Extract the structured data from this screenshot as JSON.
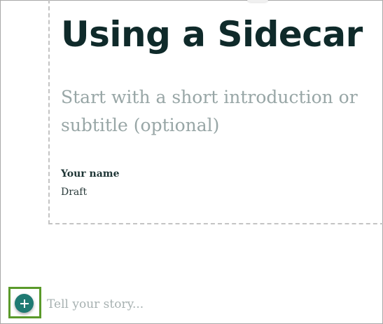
{
  "story": {
    "title": "Using a Sidecar",
    "subtitle": "Start with a short introduction or subtitle (optional)",
    "byline": {
      "name": "Your name",
      "status": "Draft"
    }
  },
  "composer": {
    "add_icon": "plus-icon",
    "placeholder": "Tell your story..."
  },
  "colors": {
    "title": "#0f2a2a",
    "subtitle": "#98a6a6",
    "accent": "#1f7a72",
    "highlight": "#5a9a2a"
  }
}
